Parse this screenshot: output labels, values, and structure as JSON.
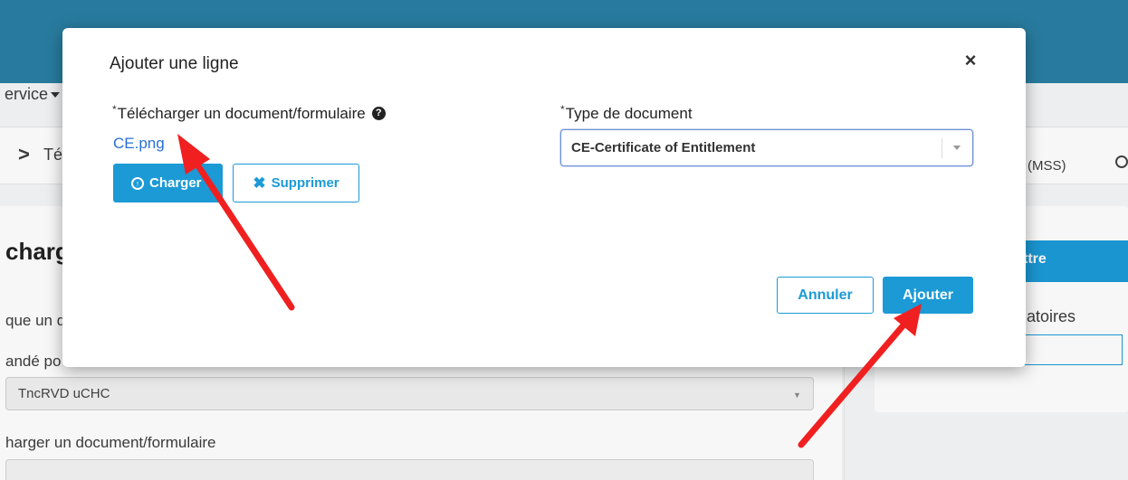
{
  "background": {
    "service_menu": "ervice",
    "breadcrumb_chevron": ">",
    "breadcrumb_item": "Té",
    "right_mss": "(MSS)",
    "heading": "charg",
    "line1": "que un d",
    "line2": "andé po",
    "select_value": "TncRVD uCHC",
    "line3": "harger un document/formulaire",
    "submit_label": "ttre",
    "obligatoires": "ligatoires",
    "right_input_text": "e"
  },
  "modal": {
    "title": "Ajouter une ligne",
    "close_glyph": "×",
    "upload_field": {
      "required_mark": "*",
      "label": "Télécharger un document/formulaire",
      "help_glyph": "?",
      "file_name": "CE.png",
      "upload_button": "Charger",
      "delete_button": "Supprimer"
    },
    "doc_type_field": {
      "required_mark": "*",
      "label": "Type de document",
      "selected_value": "CE-Certificate of Entitlement"
    },
    "cancel_button": "Annuler",
    "add_button": "Ajouter"
  },
  "colors": {
    "primary": "#1b9ad6",
    "header_bar": "#2a7fa4",
    "link": "#2a6fd6",
    "annotation_arrow": "#f02020"
  }
}
